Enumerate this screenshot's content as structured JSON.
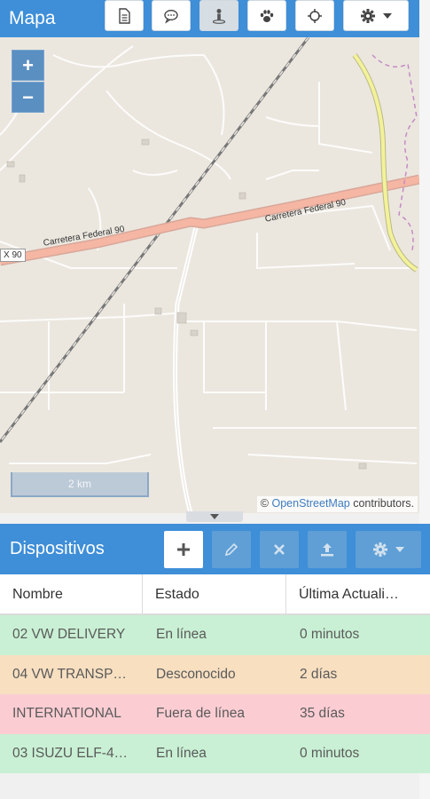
{
  "map": {
    "title": "Mapa",
    "toolbar": {
      "report_icon": "document-icon",
      "chat_icon": "chat-icon",
      "person_icon": "geofence-person-icon",
      "paw_icon": "paw-icon",
      "locate_icon": "crosshair-icon",
      "settings_icon": "gear-icon"
    },
    "zoom_in": "+",
    "zoom_out": "−",
    "scale_label": "2 km",
    "attribution_prefix": "© ",
    "attribution_link": "OpenStreetMap",
    "attribution_suffix": " contributors.",
    "road_label_1": "Carretera Federal 90",
    "road_label_2": "Carretera Federal 90",
    "road_label_3": "X 90"
  },
  "devices": {
    "title": "Dispositivos",
    "columns": [
      "Nombre",
      "Estado",
      "Última Actuali…"
    ],
    "rows": [
      {
        "name": "02 VW DELIVERY",
        "status": "En línea",
        "updated": "0 minutos"
      },
      {
        "name": "04 VW TRANSP…",
        "status": "Desconocido",
        "updated": "2 días"
      },
      {
        "name": "INTERNATIONAL",
        "status": "Fuera de línea",
        "updated": "35 días"
      },
      {
        "name": "03 ISUZU ELF-4…",
        "status": "En línea",
        "updated": "0 minutos"
      }
    ]
  },
  "colors": {
    "header_blue": "#3e8ed8",
    "online": "#c9f0d4",
    "unknown": "#f7dfc0",
    "offline": "#fbcdd3"
  }
}
